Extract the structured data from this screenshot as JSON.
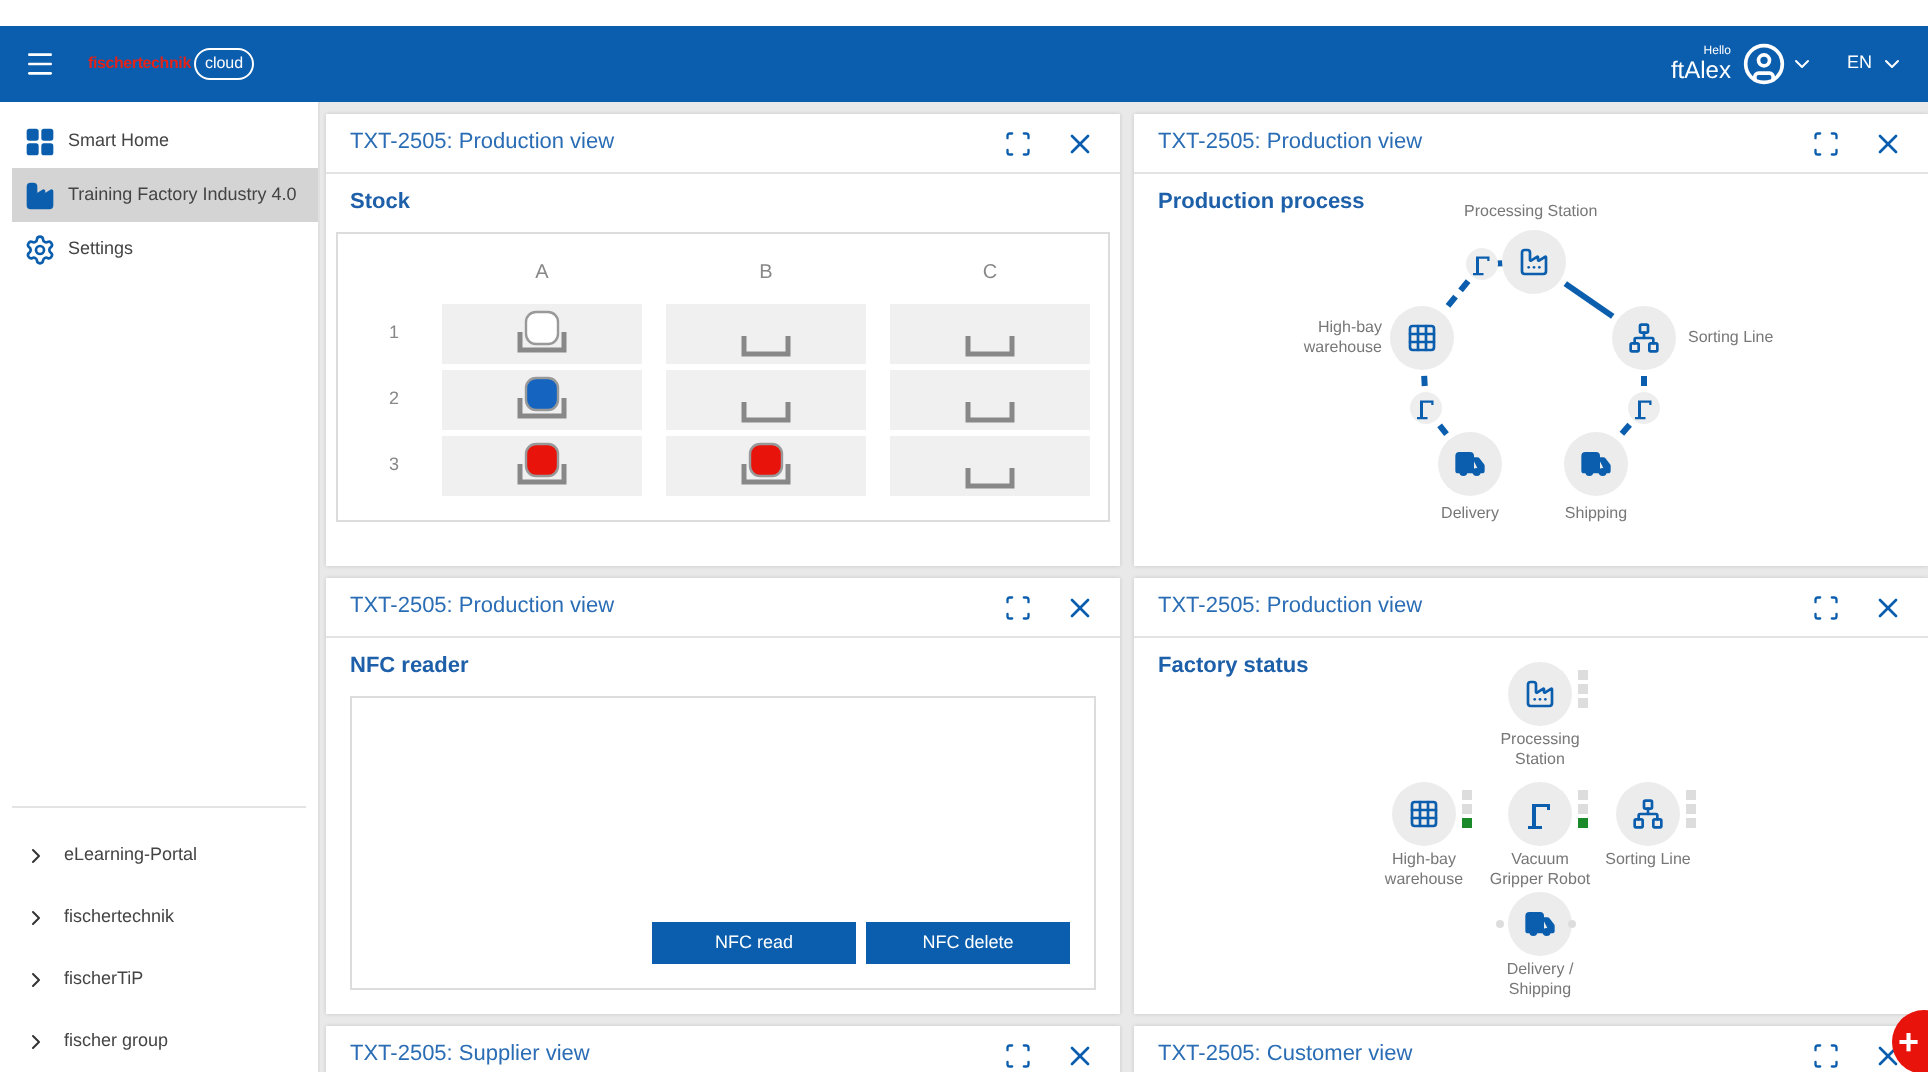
{
  "header": {
    "logo_brand": "fischertechnik",
    "logo_cloud": "cloud",
    "greeting": "Hello",
    "user": "ftAlex",
    "language": "EN"
  },
  "sidebar": {
    "items": [
      {
        "label": "Smart Home",
        "kind": "home",
        "selected": false
      },
      {
        "label": "Training Factory Industry 4.0",
        "kind": "factory",
        "selected": true
      },
      {
        "label": "Settings",
        "kind": "settings",
        "selected": false
      }
    ],
    "links": [
      "eLearning-Portal",
      "fischertechnik",
      "fischerTiP",
      "fischer group"
    ]
  },
  "panels": [
    {
      "kind": "stock",
      "title": "TXT-2505: Production view",
      "heading": "Stock",
      "columns": [
        "A",
        "B",
        "C"
      ],
      "rows": [
        {
          "label": "1",
          "cells": [
            {
              "kind": "workpiece",
              "color": "#ffffff"
            },
            {
              "kind": "empty"
            },
            {
              "kind": "empty"
            }
          ]
        },
        {
          "label": "2",
          "cells": [
            {
              "kind": "workpiece",
              "color": "#1565c0"
            },
            {
              "kind": "empty"
            },
            {
              "kind": "empty"
            }
          ]
        },
        {
          "label": "3",
          "cells": [
            {
              "kind": "workpiece",
              "color": "#e8140c"
            },
            {
              "kind": "workpiece",
              "color": "#e8140c"
            },
            {
              "kind": "empty"
            }
          ]
        }
      ]
    },
    {
      "kind": "process",
      "title": "TXT-2505: Production view",
      "heading": "Production process",
      "stations": [
        {
          "label": "Processing Station",
          "kind": "factory"
        },
        {
          "label": "Sorting Line",
          "kind": "sorting"
        },
        {
          "label": "Shipping",
          "kind": "truck"
        },
        {
          "label": "Delivery",
          "kind": "truck"
        },
        {
          "label": "High-bay warehouse",
          "kind": "warehouse"
        }
      ]
    },
    {
      "kind": "nfc",
      "title": "TXT-2505: Production view",
      "heading": "NFC reader",
      "buttons": [
        "NFC read",
        "NFC delete"
      ]
    },
    {
      "kind": "status",
      "title": "TXT-2505: Production view",
      "heading": "Factory status",
      "stations": [
        {
          "label": "Processing Station",
          "kind": "factory",
          "ready": false
        },
        {
          "label": "High-bay warehouse",
          "kind": "warehouse",
          "ready": true
        },
        {
          "label": "Vacuum Gripper Robot",
          "kind": "crane",
          "ready": true
        },
        {
          "label": "Sorting Line",
          "kind": "sorting",
          "ready": false
        },
        {
          "label": "Delivery / Shipping",
          "kind": "trucks",
          "ready": false
        }
      ]
    },
    {
      "kind": "collapsed",
      "title": "TXT-2505: Supplier view"
    },
    {
      "kind": "collapsed",
      "title": "TXT-2505: Customer view"
    }
  ],
  "fab": "+"
}
